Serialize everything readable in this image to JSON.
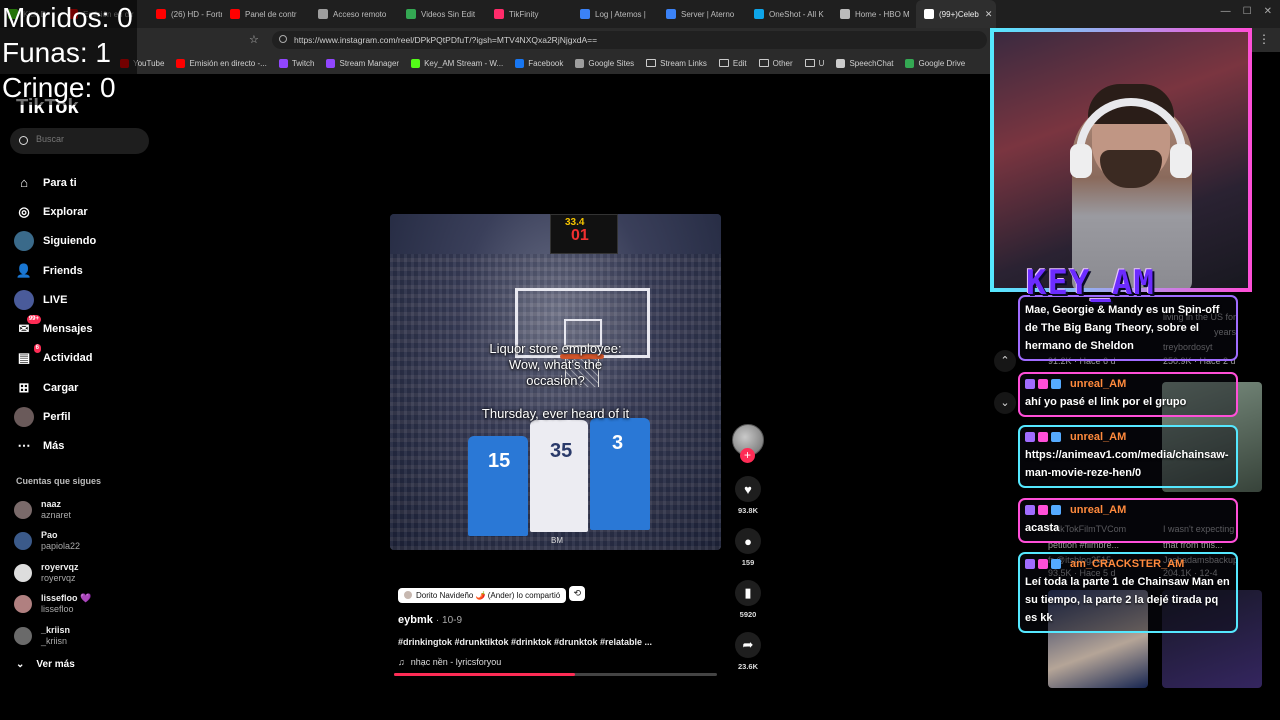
{
  "overlay": {
    "morido": "Moridos: 0",
    "funas": "Funas: 1",
    "cringe": "Cringe: 0"
  },
  "browser": {
    "tabs": [
      {
        "label": "Kick D",
        "color": "#53fc18"
      },
      {
        "label": "Emisión en dir",
        "color": "#ff0000"
      },
      {
        "label": "(26) HD - Fortn",
        "color": "#ff0000"
      },
      {
        "label": "Panel de contr",
        "color": "#ff0000"
      },
      {
        "label": "Acceso remoto",
        "color": "#9e9e9e"
      },
      {
        "label": "Videos Sin Edit",
        "color": "#34a853"
      },
      {
        "label": "TikFinity",
        "color": "#ff2b6a"
      },
      {
        "label": "Log | Atemos |",
        "color": "#3b82f6"
      },
      {
        "label": "Server | Aterno",
        "color": "#3b82f6"
      },
      {
        "label": "OneShot - All K",
        "color": "#0ea5e9"
      },
      {
        "label": "Home - HBO M",
        "color": "#bbbbbb"
      },
      {
        "label": "(99+)Celeb",
        "color": "#ffffff"
      }
    ],
    "url": "https://www.instagram.com/reel/DPkPQtPDfuT/?igsh=MTV4NXQxa2RjNjgxdA==",
    "bookmarks": [
      {
        "label": "YouTube",
        "color": "#ff0000",
        "kind": "site"
      },
      {
        "label": "Emisión en directo -...",
        "color": "#ff0000",
        "kind": "site"
      },
      {
        "label": "Twitch",
        "color": "#9146ff",
        "kind": "site"
      },
      {
        "label": "Stream Manager",
        "color": "#9146ff",
        "kind": "site"
      },
      {
        "label": "Key_AM Stream - W...",
        "color": "#53fc18",
        "kind": "site"
      },
      {
        "label": "Facebook",
        "color": "#1877f2",
        "kind": "site"
      },
      {
        "label": "Google Sites",
        "color": "#9e9e9e",
        "kind": "site"
      },
      {
        "label": "Stream Links",
        "color": "",
        "kind": "folder"
      },
      {
        "label": "Edit",
        "color": "",
        "kind": "folder"
      },
      {
        "label": "Other",
        "color": "",
        "kind": "folder"
      },
      {
        "label": "U",
        "color": "",
        "kind": "folder"
      },
      {
        "label": "SpeechChat",
        "color": "#cccccc",
        "kind": "site"
      },
      {
        "label": "Google Drive",
        "color": "#34a853",
        "kind": "site"
      }
    ]
  },
  "sidebar": {
    "logo": "TikTok",
    "search_placeholder": "Buscar",
    "nav": [
      {
        "label": "Para ti",
        "icon": "home-icon",
        "glyph": "⌂"
      },
      {
        "label": "Explorar",
        "icon": "compass-icon",
        "glyph": "◎"
      },
      {
        "label": "Siguiendo",
        "icon": "following-avatar",
        "glyph": ""
      },
      {
        "label": "Friends",
        "icon": "friends-icon",
        "glyph": "👤"
      },
      {
        "label": "LIVE",
        "icon": "live-avatar",
        "glyph": ""
      },
      {
        "label": "Mensajes",
        "icon": "messages-icon",
        "glyph": "✉",
        "badge": "99+"
      },
      {
        "label": "Actividad",
        "icon": "activity-icon",
        "glyph": "▤",
        "badge": "6"
      },
      {
        "label": "Cargar",
        "icon": "upload-icon",
        "glyph": "⊞"
      },
      {
        "label": "Perfil",
        "icon": "profile-avatar",
        "glyph": ""
      },
      {
        "label": "Más",
        "icon": "more-icon",
        "glyph": "⋯"
      }
    ],
    "following_title": "Cuentas que sigues",
    "following": [
      {
        "user": "naaz",
        "name": "aznaret",
        "color": "#7a6a6a"
      },
      {
        "user": "Pao",
        "name": "papiola22",
        "color": "#3b5a8a"
      },
      {
        "user": "royervqz",
        "name": "royervqz",
        "color": "#dddddd"
      },
      {
        "user": "lisseflоо 💜",
        "name": "lisseflоо",
        "color": "#b08080"
      },
      {
        "user": "_kriisn",
        "name": "_kriisn",
        "color": "#6a6a6a"
      }
    ],
    "ver_mas": "Ver más"
  },
  "video": {
    "scoreboard_top": "33.4",
    "scoreboard_main": "01",
    "caption_1": "Liquor store employee:",
    "caption_2": "Wow, what's the",
    "caption_3": "occasion?",
    "caption_4": "Thursday, ever heard of it",
    "jersey_1": "15",
    "jersey_2": "35",
    "jersey_3": "3",
    "watermark": "BM",
    "progress": 0.56
  },
  "actions": {
    "likes": "93.8K",
    "comments": "159",
    "saves": "5920",
    "shares": "23.6K"
  },
  "post": {
    "collab_text": "Dorito Navideño 🌶️ (Ander) lo compartió",
    "author": "eybmk",
    "date": "· 10-9",
    "tags": "#drinkingtok #drunktiktok #drinktok #drunktok #relatable ...",
    "music": "nhạc nền - lyricsforyou"
  },
  "background_page": {
    "item_1": "living in the US for",
    "item_2": "years:",
    "item_3": "treybordosyt",
    "item_4": "91.2K · Hace 6 d",
    "item_5": "250.9K · Hace 2 d",
    "item_6": "#TikTokFilmTVCom",
    "item_7": "petition #filmbre...",
    "item_8": "I wasn't expecting",
    "item_9": "that from this...",
    "item_10": "93.5K · Hace 5 d",
    "item_11": "204.1K · 12-4",
    "item_12": "fr @itsblog2515",
    "item_13": "Joshadamsbackup"
  },
  "stream": {
    "channel_name": "KEY_AM"
  },
  "chat": [
    {
      "user": "",
      "text": "Mae, Georgie & Mandy es un Spin-off de The Big Bang Theory, sobre el hermano de Sheldon",
      "border": "#a06cff"
    },
    {
      "user": "unreal_AM",
      "text": "ahí yo pasé el link por el grupo",
      "border": "#ff4fd8"
    },
    {
      "user": "unreal_AM",
      "text": "https://animeav1.com/media/chainsaw-man-movie-reze-hen/0",
      "border": "#55e8ff"
    },
    {
      "user": "unreal_AM",
      "text": "acasta",
      "border": "#ff4fd8"
    },
    {
      "user": "am_CRACKSTER_AM",
      "text": "Leí toda la parte 1 de Chainsaw Man en su tiempo, la parte 2 la dejé tirada pq es kk",
      "border": "#55e8ff"
    }
  ]
}
